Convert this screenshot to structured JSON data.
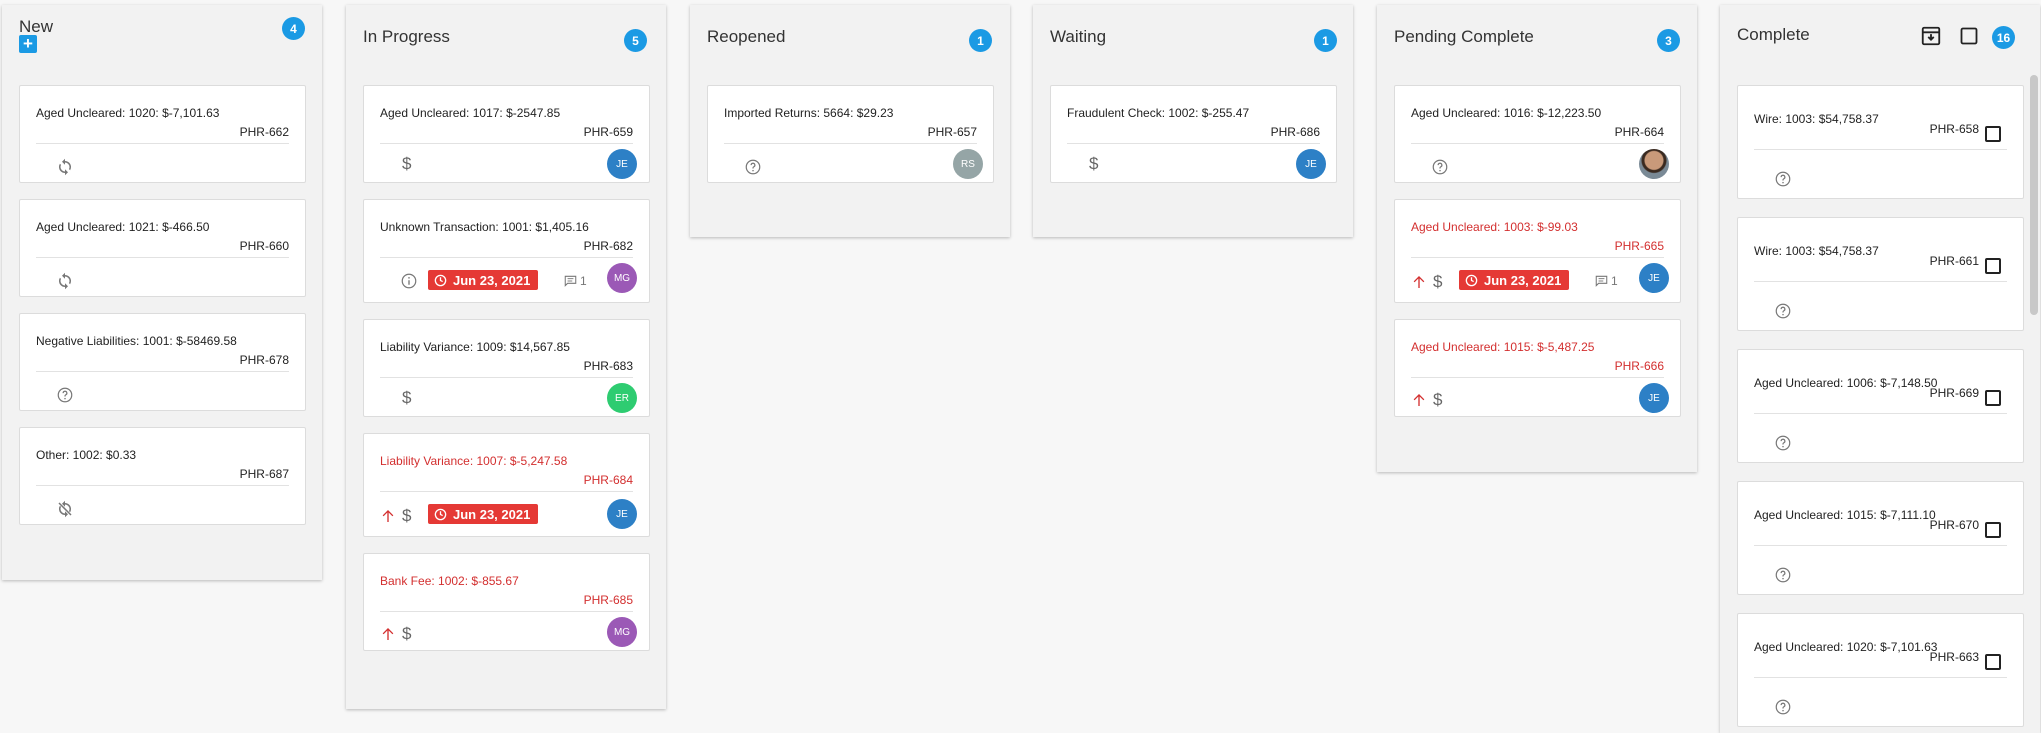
{
  "columns": {
    "new": {
      "title": "New",
      "count": "4",
      "add_label": "+",
      "cards": [
        {
          "title": "Aged Uncleared: 1020: $-7,101.63",
          "code": "PHR-662"
        },
        {
          "title": "Aged Uncleared: 1021: $-466.50",
          "code": "PHR-660"
        },
        {
          "title": "Negative Liabilities: 1001: $-58469.58",
          "code": "PHR-678"
        },
        {
          "title": "Other: 1002: $0.33",
          "code": "PHR-687"
        }
      ]
    },
    "in_progress": {
      "title": "In Progress",
      "count": "5",
      "cards": [
        {
          "title": "Aged Uncleared: 1017: $-2547.85",
          "code": "PHR-659",
          "avatar": "JE"
        },
        {
          "title": "Unknown Transaction: 1001: $1,405.16",
          "code": "PHR-682",
          "due": "Jun 23, 2021",
          "comments": "1",
          "avatar": "MG"
        },
        {
          "title": "Liability Variance: 1009: $14,567.85",
          "code": "PHR-683",
          "avatar": "ER"
        },
        {
          "title": "Liability Variance: 1007: $-5,247.58",
          "code": "PHR-684",
          "due": "Jun 23, 2021",
          "avatar": "JE"
        },
        {
          "title": "Bank Fee: 1002: $-855.67",
          "code": "PHR-685",
          "avatar": "MG"
        }
      ]
    },
    "reopened": {
      "title": "Reopened",
      "count": "1",
      "cards": [
        {
          "title": "Imported Returns: 5664: $29.23",
          "code": "PHR-657",
          "avatar": "RS"
        }
      ]
    },
    "waiting": {
      "title": "Waiting",
      "count": "1",
      "cards": [
        {
          "title": "Fraudulent Check: 1002: $-255.47",
          "code": "PHR-686",
          "avatar": "JE"
        }
      ]
    },
    "pending_complete": {
      "title": "Pending Complete",
      "count": "3",
      "cards": [
        {
          "title": "Aged Uncleared: 1016: $-12,223.50",
          "code": "PHR-664"
        },
        {
          "title": "Aged Uncleared: 1003: $-99.03",
          "code": "PHR-665",
          "due": "Jun 23, 2021",
          "comments": "1",
          "avatar": "JE"
        },
        {
          "title": "Aged Uncleared: 1015: $-5,487.25",
          "code": "PHR-666",
          "avatar": "JE"
        }
      ]
    },
    "complete": {
      "title": "Complete",
      "count": "16",
      "cards": [
        {
          "title": "Wire: 1003: $54,758.37",
          "code": "PHR-658"
        },
        {
          "title": "Wire: 1003: $54,758.37",
          "code": "PHR-661"
        },
        {
          "title": "Aged Uncleared: 1006: $-7,148.50",
          "code": "PHR-669"
        },
        {
          "title": "Aged Uncleared: 1015: $-7,111.10",
          "code": "PHR-670"
        },
        {
          "title": "Aged Uncleared: 1020: $-7,101.63",
          "code": "PHR-663"
        }
      ]
    }
  },
  "icons": {
    "dollar": "$"
  },
  "colors": {
    "accent": "#1b9ae4",
    "alert": "#d32f2f",
    "due_pill": "#e53935"
  }
}
